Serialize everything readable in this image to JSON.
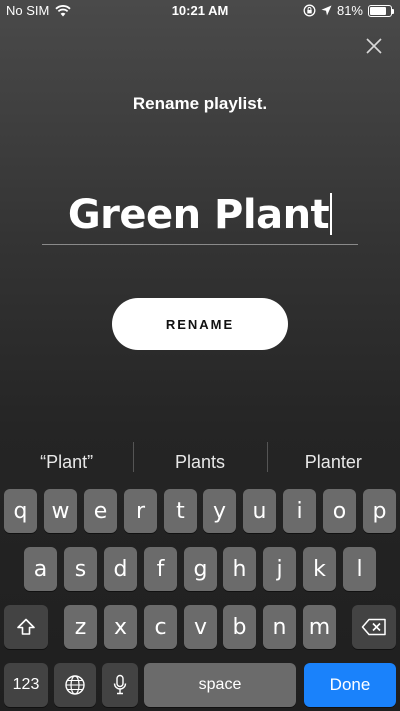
{
  "status_bar": {
    "carrier": "No SIM",
    "time": "10:21 AM",
    "battery_percent": "81%",
    "battery_level": 0.81,
    "icons": [
      "wifi-icon",
      "orientation-lock-icon",
      "location-arrow-icon",
      "battery-icon"
    ]
  },
  "dialog": {
    "title": "Rename playlist.",
    "name_value": "Green Plant",
    "rename_label": "RENAME",
    "close_icon": "close-icon"
  },
  "keyboard": {
    "suggestions": [
      "“Plant”",
      "Plants",
      "Planter"
    ],
    "row1": [
      "q",
      "w",
      "e",
      "r",
      "t",
      "y",
      "u",
      "i",
      "o",
      "p"
    ],
    "row2": [
      "a",
      "s",
      "d",
      "f",
      "g",
      "h",
      "j",
      "k",
      "l"
    ],
    "row3": [
      "z",
      "x",
      "c",
      "v",
      "b",
      "n",
      "m"
    ],
    "numbers_label": "123",
    "space_label": "space",
    "done_label": "Done",
    "shift_icon": "shift-icon",
    "backspace_icon": "backspace-icon",
    "globe_icon": "globe-icon",
    "mic_icon": "microphone-icon",
    "accent_color": "#1a82fb"
  }
}
